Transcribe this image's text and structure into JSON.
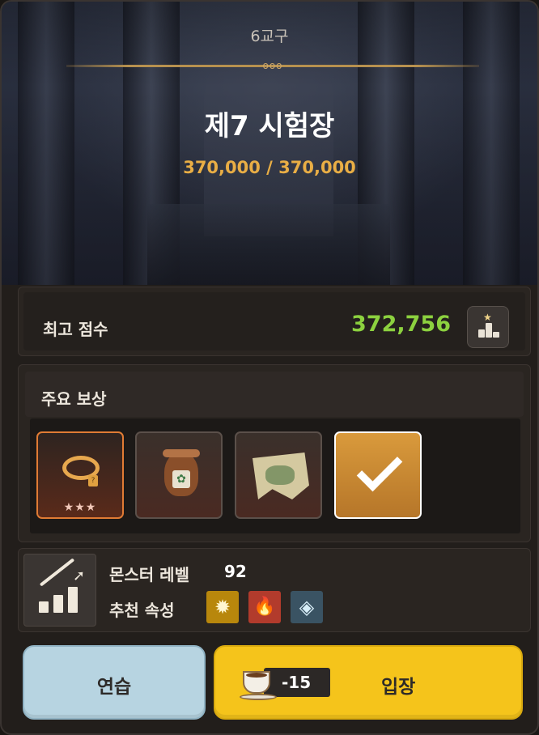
{
  "header": {
    "district": "6교구",
    "divider_ornament": "ooo",
    "stage_title": "제7 시험장",
    "stage_score": "370,000 / 370,000"
  },
  "best_score": {
    "label": "최고 점수",
    "value": "372,756",
    "ranking_icon": "ranking-podium-icon"
  },
  "rewards": {
    "title": "주요 보상",
    "items": [
      {
        "name": "ring",
        "icon": "ring-icon",
        "tag": "?",
        "stars": "★★★",
        "grade_color": "#e07b34"
      },
      {
        "name": "pouch",
        "icon": "pouch-icon",
        "label_glyph": "✿"
      },
      {
        "name": "map",
        "icon": "map-icon"
      },
      {
        "name": "selected-reward",
        "icon": "check-icon",
        "selected": true
      }
    ]
  },
  "monster": {
    "level_label": "몬스터 레벨",
    "level_value": "92",
    "attribute_label": "추천 속성",
    "attributes": [
      {
        "name": "light",
        "icon": "sun-icon",
        "glyph": "✹",
        "color": "#b8870c"
      },
      {
        "name": "fire",
        "icon": "fire-icon",
        "glyph": "🔥",
        "color": "#b23b2c"
      },
      {
        "name": "wind",
        "icon": "wind-spiral-icon",
        "glyph": "◈",
        "color": "#3a5363"
      }
    ]
  },
  "actions": {
    "practice_label": "연습",
    "enter_label": "입장",
    "cost_value": "-15",
    "cost_icon": "coffee-cup-icon"
  },
  "colors": {
    "score_accent": "#e9ae45",
    "best_score": "#8cd13f",
    "enter_button": "#f5c41b",
    "practice_button": "#b7d4e1"
  }
}
